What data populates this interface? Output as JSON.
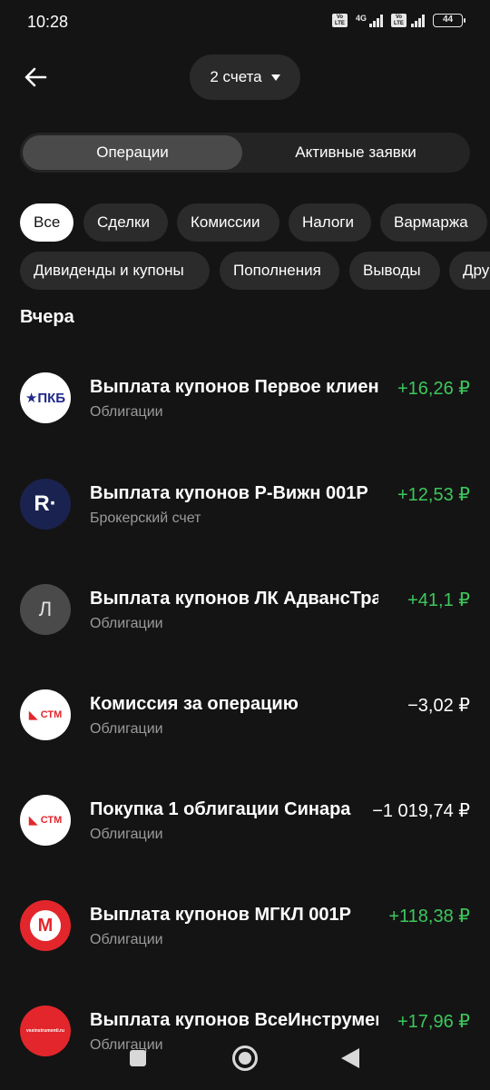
{
  "status_bar": {
    "time": "10:28",
    "network": "4G",
    "battery": "44"
  },
  "header": {
    "account_selector": "2 счета"
  },
  "tabs": {
    "operations": "Операции",
    "active_orders": "Активные заявки"
  },
  "filters": {
    "row1": [
      "Все",
      "Сделки",
      "Комиссии",
      "Налоги",
      "Вармаржа"
    ],
    "row2": [
      "Дивиденды и купоны",
      "Пополнения",
      "Выводы",
      "Другое"
    ]
  },
  "section": {
    "title": "Вчера"
  },
  "operations": [
    {
      "title": "Выплата купонов Первое клиентское",
      "subtitle": "Облигации",
      "amount": "+16,26 ₽",
      "logo": "pkb-logo",
      "logo_text": "★ПКБ"
    },
    {
      "title": "Выплата купонов Р-Вижн 001Р",
      "subtitle": "Брокерский счет",
      "amount": "+12,53 ₽",
      "logo": "r-vision-logo",
      "logo_text": "R·"
    },
    {
      "title": "Выплата купонов ЛК АдвансТрак",
      "subtitle": "Облигации",
      "amount": "+41,1 ₽",
      "logo": "letter-avatar",
      "logo_text": "Л"
    },
    {
      "title": "Комиссия за операцию",
      "subtitle": "Облигации",
      "amount": "−3,02 ₽",
      "logo": "stm-logo",
      "logo_text": "СТМ"
    },
    {
      "title": "Покупка 1 облигации Синара",
      "subtitle": "Облигации",
      "amount": "−1 019,74 ₽",
      "logo": "stm-logo",
      "logo_text": "СТМ"
    },
    {
      "title": "Выплата купонов МГКЛ 001Р",
      "subtitle": "Облигации",
      "amount": "+118,38 ₽",
      "logo": "mgkl-logo",
      "logo_text": "M"
    },
    {
      "title": "Выплата купонов ВсеИнструменты",
      "subtitle": "Облигации",
      "amount": "+17,96 ₽",
      "logo": "vseinstrumenty-logo",
      "logo_text": "vseinstrumenti.ru"
    }
  ],
  "colors": {
    "positive": "#3cc85c",
    "background": "#141414",
    "chip": "#2b2b2b"
  }
}
